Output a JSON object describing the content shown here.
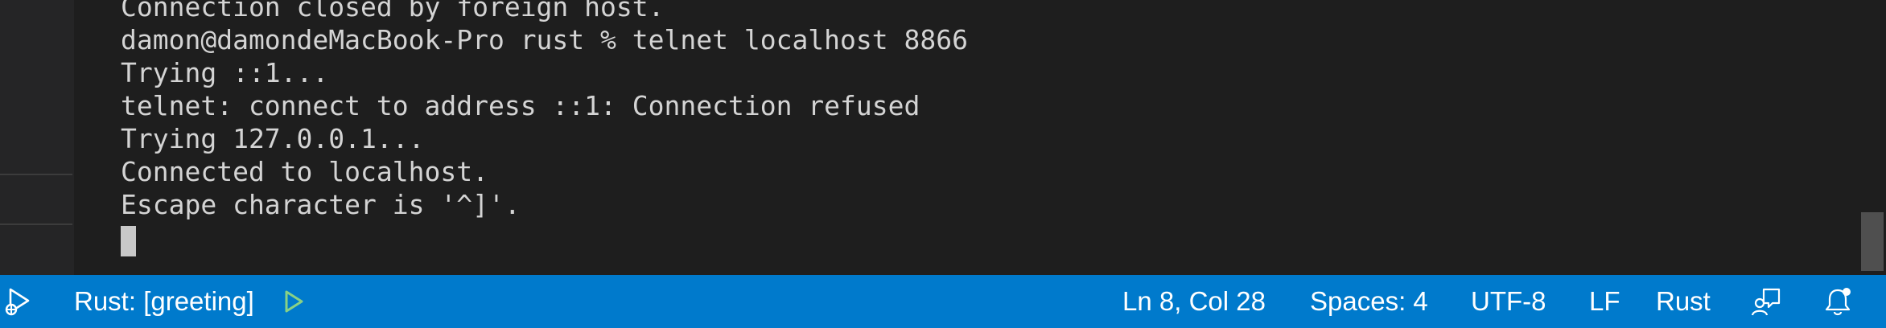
{
  "terminal": {
    "lines": [
      "Connection closed by foreign host.",
      "damon@damondeMacBook-Pro rust % telnet localhost 8866",
      "Trying ::1...",
      "telnet: connect to address ::1: Connection refused",
      "Trying 127.0.0.1...",
      "Connected to localhost.",
      "Escape character is '^]'."
    ]
  },
  "statusbar": {
    "left_icon": "debug-run-icon",
    "target_label": "Rust: [greeting]",
    "run_icon": "play-icon",
    "cursor_position": "Ln 8, Col 28",
    "indentation": "Spaces: 4",
    "encoding": "UTF-8",
    "line_ending": "LF",
    "language": "Rust",
    "feedback_icon": "feedback-icon",
    "notifications_icon": "bell-icon"
  },
  "colors": {
    "statusbar_bg": "#007acc",
    "terminal_bg": "#1e1e1e",
    "terminal_text": "#d4d4d4",
    "run_icon": "#89d185"
  }
}
